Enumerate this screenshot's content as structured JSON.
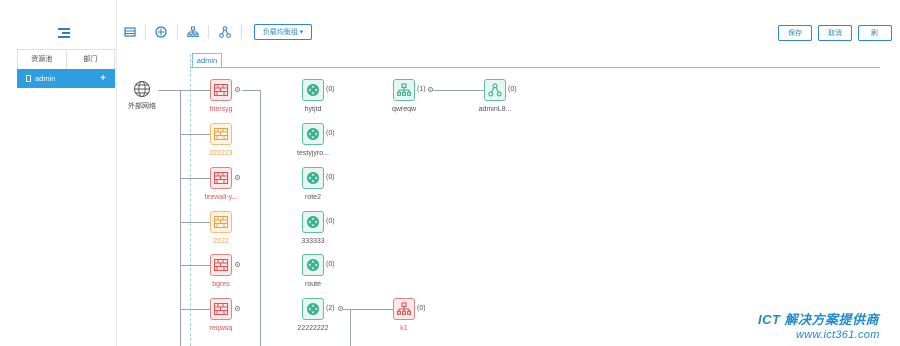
{
  "sidebar": {
    "tabs": [
      "资源池",
      "部门"
    ],
    "tree_item": "admin",
    "add_symbol": "+"
  },
  "toolbar": {
    "dropdown_label": "负载均衡组 ▾",
    "save_label": "保存",
    "cancel_label": "取消",
    "third_label": "刷"
  },
  "canvas": {
    "tab_label": "admin",
    "external_network_label": "外部网络",
    "firewalls": [
      {
        "name": "htersyg",
        "status": "red"
      },
      {
        "name": "222223",
        "status": "orange"
      },
      {
        "name": "firewall-y...",
        "status": "red"
      },
      {
        "name": "2222",
        "status": "orange"
      },
      {
        "name": "bgres",
        "status": "red"
      },
      {
        "name": "reqwsq",
        "status": "red"
      }
    ],
    "routers": [
      {
        "name": "hytjtd",
        "count": "(0)"
      },
      {
        "name": "testyjyro...",
        "count": "(0)"
      },
      {
        "name": "rote2",
        "count": "(0)"
      },
      {
        "name": "333333",
        "count": "(0)"
      },
      {
        "name": "route",
        "count": "(0)"
      },
      {
        "name": "22222222",
        "count": "(2)"
      }
    ],
    "loadbalancer": {
      "name": "qwreqw",
      "count": "(1)"
    },
    "loadbalancer_child": {
      "name": "adminL8...",
      "count": "(0)"
    },
    "subnet_child": {
      "name": "k1",
      "count": "(0)"
    }
  },
  "watermark": {
    "line1": "ICT 解决方案提供商",
    "line2": "www.ict361.com"
  },
  "colors": {
    "accent": "#2d9ee0",
    "firewall_red": "#e05353",
    "firewall_orange": "#f0a040",
    "router_green": "#3bb08f"
  }
}
